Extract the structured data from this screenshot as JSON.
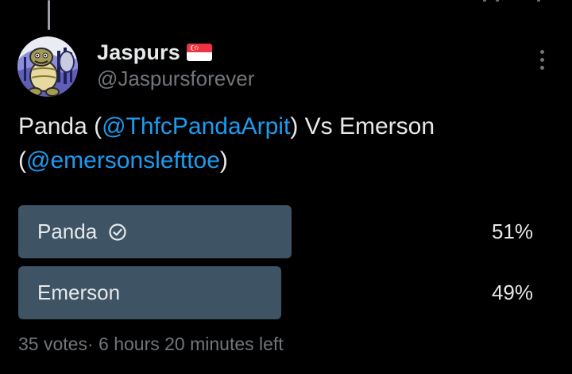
{
  "author": {
    "display_name": "Jaspurs",
    "handle": "@Jaspursforever",
    "flag_icon": "singapore-flag-icon"
  },
  "tweet": {
    "text_part1": "Panda (",
    "mention1": "@ThfcPandaArpit",
    "text_part2": ") Vs Emerson (",
    "mention2": "@emersonslefttoe",
    "text_part3": ")"
  },
  "poll": {
    "options": [
      {
        "label": "Panda",
        "percent": "51%",
        "share": 0.51,
        "winner": true,
        "winner_icon": "check-circle-icon"
      },
      {
        "label": "Emerson",
        "percent": "49%",
        "share": 0.49,
        "winner": false
      }
    ],
    "votes": "35 votes",
    "separator": "·",
    "time_left": "6 hours 20 minutes left"
  },
  "colors": {
    "background": "#000000",
    "text_primary": "#e7e9ea",
    "text_secondary": "#71767b",
    "mention": "#1d9bf0",
    "poll_fill": "#3e5465"
  }
}
